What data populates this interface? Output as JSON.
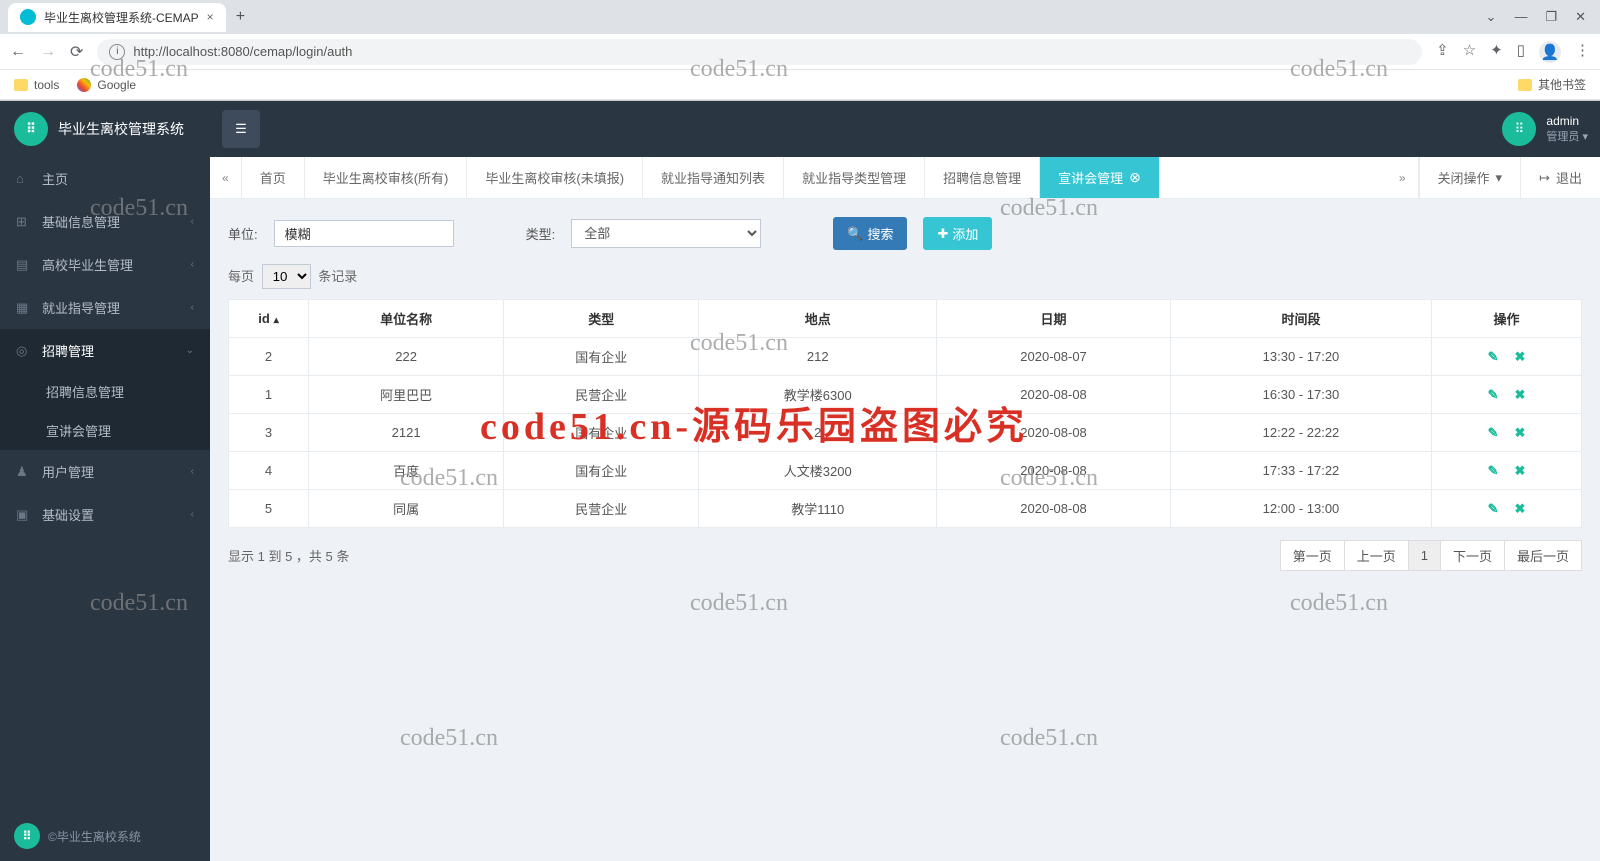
{
  "browser": {
    "tab_title": "毕业生离校管理系统-CEMAP",
    "url": "http://localhost:8080/cemap/login/auth",
    "bookmarks": {
      "tools": "tools",
      "google": "Google",
      "other": "其他书签"
    }
  },
  "sidebar": {
    "app_title": "毕业生离校管理系统",
    "items": [
      {
        "icon": "home-icon",
        "label": "主页"
      },
      {
        "icon": "dashboard-icon",
        "label": "基础信息管理"
      },
      {
        "icon": "book-icon",
        "label": "高校毕业生管理"
      },
      {
        "icon": "guide-icon",
        "label": "就业指导管理"
      },
      {
        "icon": "recruit-icon",
        "label": "招聘管理"
      },
      {
        "icon": "user-icon",
        "label": "用户管理"
      },
      {
        "icon": "settings-icon",
        "label": "基础设置"
      }
    ],
    "submenu": [
      {
        "label": "招聘信息管理"
      },
      {
        "label": "宣讲会管理"
      }
    ],
    "footer": "©毕业生离校系统"
  },
  "topbar": {
    "username": "admin",
    "role": "管理员"
  },
  "page_tabs": {
    "items": [
      {
        "label": "首页"
      },
      {
        "label": "毕业生离校审核(所有)"
      },
      {
        "label": "毕业生离校审核(未填报)"
      },
      {
        "label": "就业指导通知列表"
      },
      {
        "label": "就业指导类型管理"
      },
      {
        "label": "招聘信息管理"
      },
      {
        "label": "宣讲会管理",
        "active": true,
        "closable": true
      }
    ],
    "left_nav": "«",
    "right_nav": "»",
    "close_ops": "关闭操作",
    "logout": "退出"
  },
  "filters": {
    "unit_label": "单位:",
    "unit_value": "模糊",
    "type_label": "类型:",
    "type_value": "全部",
    "search_btn": "搜索",
    "add_btn": "添加"
  },
  "length": {
    "prefix": "每页",
    "value": "10",
    "suffix": "条记录"
  },
  "table": {
    "headers": [
      "id",
      "单位名称",
      "类型",
      "地点",
      "日期",
      "时间段",
      "操作"
    ],
    "rows": [
      {
        "id": "2",
        "name": "222",
        "type": "国有企业",
        "place": "212",
        "date": "2020-08-07",
        "time": "13:30 - 17:20"
      },
      {
        "id": "1",
        "name": "阿里巴巴",
        "type": "民营企业",
        "place": "教学楼6300",
        "date": "2020-08-08",
        "time": "16:30 - 17:30"
      },
      {
        "id": "3",
        "name": "2121",
        "type": "国有企业",
        "place": "2",
        "date": "2020-08-08",
        "time": "12:22 - 22:22"
      },
      {
        "id": "4",
        "name": "百度",
        "type": "国有企业",
        "place": "人文楼3200",
        "date": "2020-08-08",
        "time": "17:33 - 17:22"
      },
      {
        "id": "5",
        "name": "同属",
        "type": "民营企业",
        "place": "教学1110",
        "date": "2020-08-08",
        "time": "12:00 - 13:00"
      }
    ]
  },
  "footer": {
    "info": "显示 1 到 5 ，共 5 条",
    "pages": [
      "第一页",
      "上一页",
      "1",
      "下一页",
      "最后一页"
    ]
  },
  "watermark": {
    "small": "code51.cn",
    "big": "code51.cn-源码乐园盗图必究"
  }
}
